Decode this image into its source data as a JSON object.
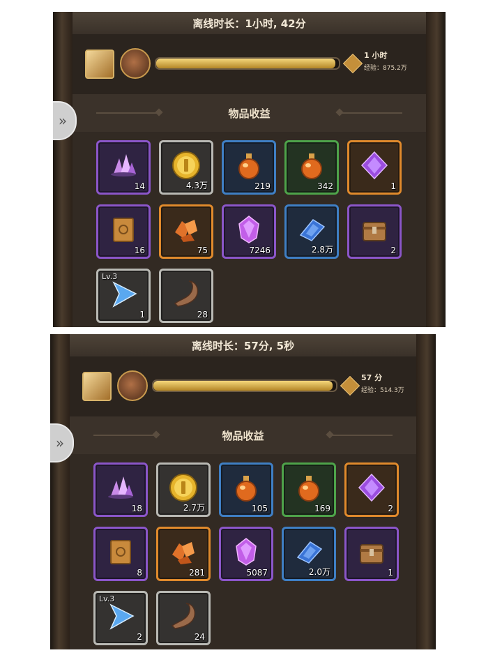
{
  "panels": [
    {
      "title": "离线时长：1小时, 42分",
      "time_label": "1 小时",
      "exp_label": "经验：875.2万",
      "progress": 0.98,
      "section_title": "物品收益",
      "items": [
        {
          "name": "purple-crystal-cluster",
          "rarity": "purple",
          "count": "14",
          "icon": "crystal-cluster-icon"
        },
        {
          "name": "gold-coin",
          "rarity": "white",
          "count": "4.3万",
          "icon": "gold-coin-icon"
        },
        {
          "name": "orange-potion",
          "rarity": "blue",
          "count": "219",
          "icon": "potion-icon"
        },
        {
          "name": "red-potion",
          "rarity": "green",
          "count": "342",
          "icon": "potion-icon"
        },
        {
          "name": "purple-gem",
          "rarity": "orange",
          "count": "1",
          "icon": "gem-icon"
        },
        {
          "name": "skill-book",
          "rarity": "purple",
          "count": "16",
          "icon": "book-icon"
        },
        {
          "name": "orange-ore",
          "rarity": "orange",
          "count": "75",
          "icon": "ore-icon"
        },
        {
          "name": "pink-crystal",
          "rarity": "purple",
          "count": "7246",
          "icon": "crystal-icon"
        },
        {
          "name": "blue-shard",
          "rarity": "blue",
          "count": "2.8万",
          "icon": "shard-icon"
        },
        {
          "name": "treasure-chest",
          "rarity": "purple",
          "count": "2",
          "icon": "chest-icon"
        },
        {
          "name": "blue-arrow-gem",
          "rarity": "white",
          "count": "1",
          "level": "Lv.3",
          "icon": "arrow-gem-icon"
        },
        {
          "name": "horn",
          "rarity": "white",
          "count": "28",
          "icon": "horn-icon"
        }
      ]
    },
    {
      "title": "离线时长：57分, 5秒",
      "time_label": "57 分",
      "exp_label": "经验：514.3万",
      "progress": 0.98,
      "section_title": "物品收益",
      "items": [
        {
          "name": "purple-crystal-cluster",
          "rarity": "purple",
          "count": "18",
          "icon": "crystal-cluster-icon"
        },
        {
          "name": "gold-coin",
          "rarity": "white",
          "count": "2.7万",
          "icon": "gold-coin-icon"
        },
        {
          "name": "orange-potion",
          "rarity": "blue",
          "count": "105",
          "icon": "potion-icon"
        },
        {
          "name": "red-potion",
          "rarity": "green",
          "count": "169",
          "icon": "potion-icon"
        },
        {
          "name": "purple-gem",
          "rarity": "orange",
          "count": "2",
          "icon": "gem-icon"
        },
        {
          "name": "skill-book",
          "rarity": "purple",
          "count": "8",
          "icon": "book-icon"
        },
        {
          "name": "orange-ore",
          "rarity": "orange",
          "count": "281",
          "icon": "ore-icon"
        },
        {
          "name": "pink-crystal",
          "rarity": "purple",
          "count": "5087",
          "icon": "crystal-icon"
        },
        {
          "name": "blue-shard",
          "rarity": "blue",
          "count": "2.0万",
          "icon": "shard-icon"
        },
        {
          "name": "treasure-chest",
          "rarity": "purple",
          "count": "1",
          "icon": "chest-icon"
        },
        {
          "name": "blue-arrow-gem",
          "rarity": "white",
          "count": "2",
          "level": "Lv.3",
          "icon": "arrow-gem-icon"
        },
        {
          "name": "horn",
          "rarity": "white",
          "count": "24",
          "icon": "horn-icon"
        }
      ]
    }
  ]
}
